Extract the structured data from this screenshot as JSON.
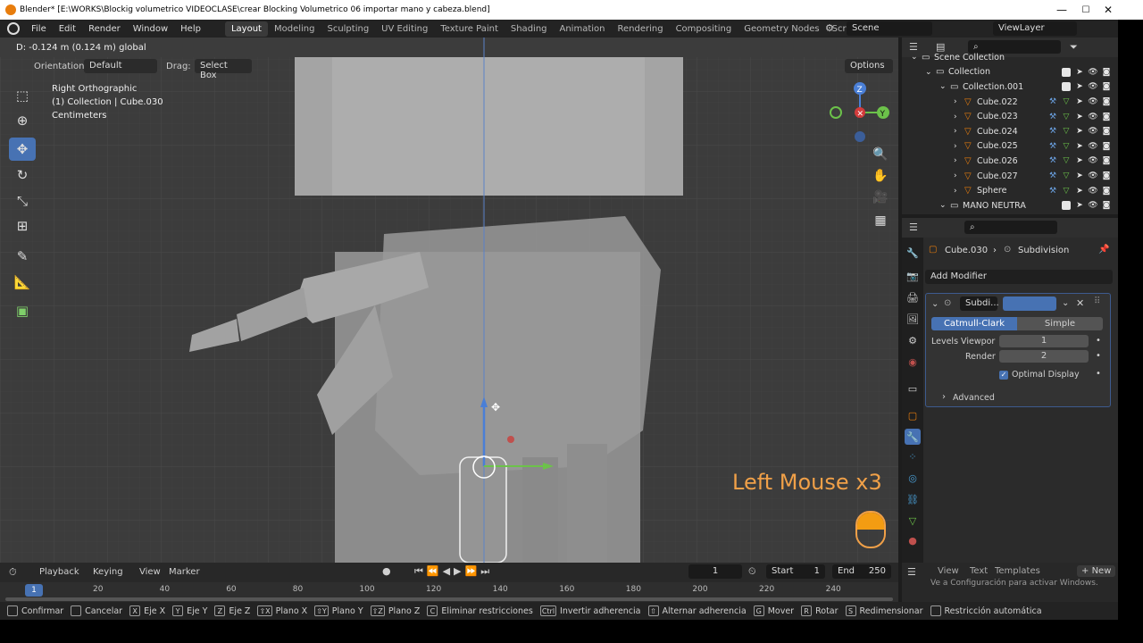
{
  "window": {
    "title": "Blender* [E:\\WORKS\\Blockig volumetrico VIDEOCLASE\\crear Blocking Volumetrico 06 importar mano y cabeza.blend]",
    "minimize": "—",
    "maximize": "☐",
    "close": "✕"
  },
  "menu": {
    "items": [
      "File",
      "Edit",
      "Render",
      "Window",
      "Help"
    ]
  },
  "workspaces": {
    "tabs": [
      "Layout",
      "Modeling",
      "Sculpting",
      "UV Editing",
      "Texture Paint",
      "Shading",
      "Animation",
      "Rendering",
      "Compositing",
      "Geometry Nodes",
      "Scripting"
    ],
    "active": "Layout",
    "add": "+"
  },
  "scene": {
    "label": "Scene",
    "viewlayer": "ViewLayer"
  },
  "header": {
    "transform_info": "D: -0.124 m (0.124 m) global",
    "orientation_label": "Orientation:",
    "orientation_value": "Default",
    "drag_label": "Drag:",
    "drag_value": "Select Box",
    "options": "Options"
  },
  "viewport": {
    "view_name": "Right Orthographic",
    "object_info": "(1) Collection | Cube.030",
    "units": "Centimeters",
    "screencast": "Left Mouse x3",
    "gizmo": {
      "z": "Z",
      "y": "Y"
    }
  },
  "outliner": {
    "rows": [
      {
        "label": "Scene Collection",
        "indent": 0,
        "type": "scene"
      },
      {
        "label": "Collection",
        "indent": 1,
        "type": "collection"
      },
      {
        "label": "Collection.001",
        "indent": 2,
        "type": "collection"
      },
      {
        "label": "Cube.022",
        "indent": 3,
        "type": "mesh"
      },
      {
        "label": "Cube.023",
        "indent": 3,
        "type": "mesh"
      },
      {
        "label": "Cube.024",
        "indent": 3,
        "type": "mesh"
      },
      {
        "label": "Cube.025",
        "indent": 3,
        "type": "mesh"
      },
      {
        "label": "Cube.026",
        "indent": 3,
        "type": "mesh"
      },
      {
        "label": "Cube.027",
        "indent": 3,
        "type": "mesh"
      },
      {
        "label": "Sphere",
        "indent": 3,
        "type": "mesh"
      },
      {
        "label": "MANO NEUTRA",
        "indent": 2,
        "type": "collection"
      }
    ]
  },
  "properties": {
    "object": "Cube.030",
    "modifier_crumb": "Subdivision",
    "add_modifier": "Add Modifier",
    "modifier_name": "Subdi...",
    "catmull": "Catmull-Clark",
    "simple": "Simple",
    "levels_label": "Levels Viewpor",
    "levels_value": "1",
    "render_label": "Render",
    "render_value": "2",
    "optimal": "Optimal Display",
    "advanced": "Advanced"
  },
  "timeline": {
    "menus": [
      "Playback",
      "Keying",
      "View",
      "Marker"
    ],
    "frame": "1",
    "start_label": "Start",
    "start": "1",
    "end_label": "End",
    "end": "250",
    "ticks": [
      "20",
      "40",
      "60",
      "80",
      "100",
      "120",
      "140",
      "160",
      "180",
      "200",
      "220",
      "240"
    ],
    "current": "1"
  },
  "asset_panel": {
    "view": "View",
    "text": "Text",
    "templates": "Templates",
    "new": "New"
  },
  "activate": "Ve a Configuración para activar Windows.",
  "status": [
    {
      "key": "",
      "label": "Confirmar"
    },
    {
      "key": "",
      "label": "Cancelar"
    },
    {
      "key": "X",
      "label": "Eje X"
    },
    {
      "key": "Y",
      "label": "Eje Y"
    },
    {
      "key": "Z",
      "label": "Eje Z"
    },
    {
      "key": "⇧X",
      "label": "Plano X"
    },
    {
      "key": "⇧Y",
      "label": "Plano Y"
    },
    {
      "key": "⇧Z",
      "label": "Plano Z"
    },
    {
      "key": "C",
      "label": "Eliminar restricciones"
    },
    {
      "key": "Ctrl",
      "label": "Invertir adherencia"
    },
    {
      "key": "⇧",
      "label": "Alternar adherencia"
    },
    {
      "key": "G",
      "label": "Mover"
    },
    {
      "key": "R",
      "label": "Rotar"
    },
    {
      "key": "S",
      "label": "Redimensionar"
    },
    {
      "key": "",
      "label": "Restricción automática"
    }
  ],
  "colors": {
    "accent": "#4772b3",
    "orange": "#e87d0d",
    "screencast": "#f0a048"
  }
}
